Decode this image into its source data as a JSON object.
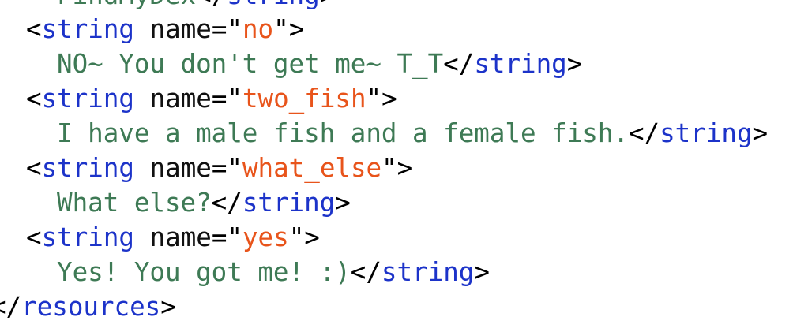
{
  "editor": {
    "lines": [
      {
        "kind": "partial",
        "text": "FindMyDex",
        "close_tag": "string"
      },
      {
        "kind": "open",
        "tag": "string",
        "attr_name": "name",
        "attr_value": "no"
      },
      {
        "kind": "content",
        "text": "NO~ You don't get me~ T_T",
        "close_tag": "string"
      },
      {
        "kind": "open",
        "tag": "string",
        "attr_name": "name",
        "attr_value": "two_fish"
      },
      {
        "kind": "content",
        "text": "I have a male fish and a female fish.",
        "close_tag": "string"
      },
      {
        "kind": "open",
        "tag": "string",
        "attr_name": "name",
        "attr_value": "what_else"
      },
      {
        "kind": "content",
        "text": "What else?",
        "close_tag": "string"
      },
      {
        "kind": "open",
        "tag": "string",
        "attr_name": "name",
        "attr_value": "yes"
      },
      {
        "kind": "content",
        "text": "Yes! You got me! :)",
        "close_tag": "string"
      },
      {
        "kind": "close",
        "close_tag": "resources"
      }
    ]
  },
  "colors": {
    "tag": "#1c33c9",
    "attribute_value": "#e8541b",
    "text_content": "#3e7a55",
    "punctuation": "#000000",
    "background": "#ffffff"
  }
}
